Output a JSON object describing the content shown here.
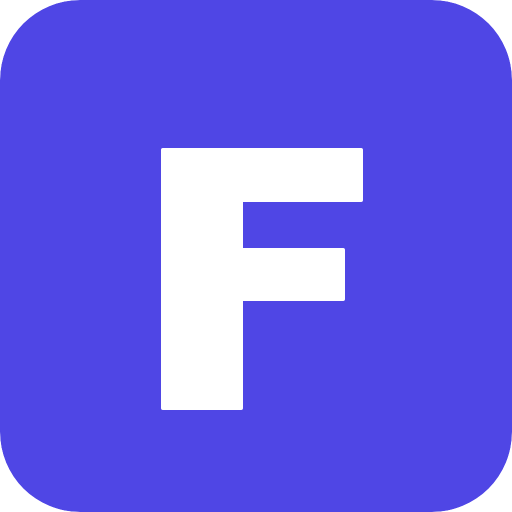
{
  "icon": {
    "name": "F app icon",
    "letter": "F",
    "background_color": "#4f46e5",
    "letter_color": "#ffffff"
  }
}
